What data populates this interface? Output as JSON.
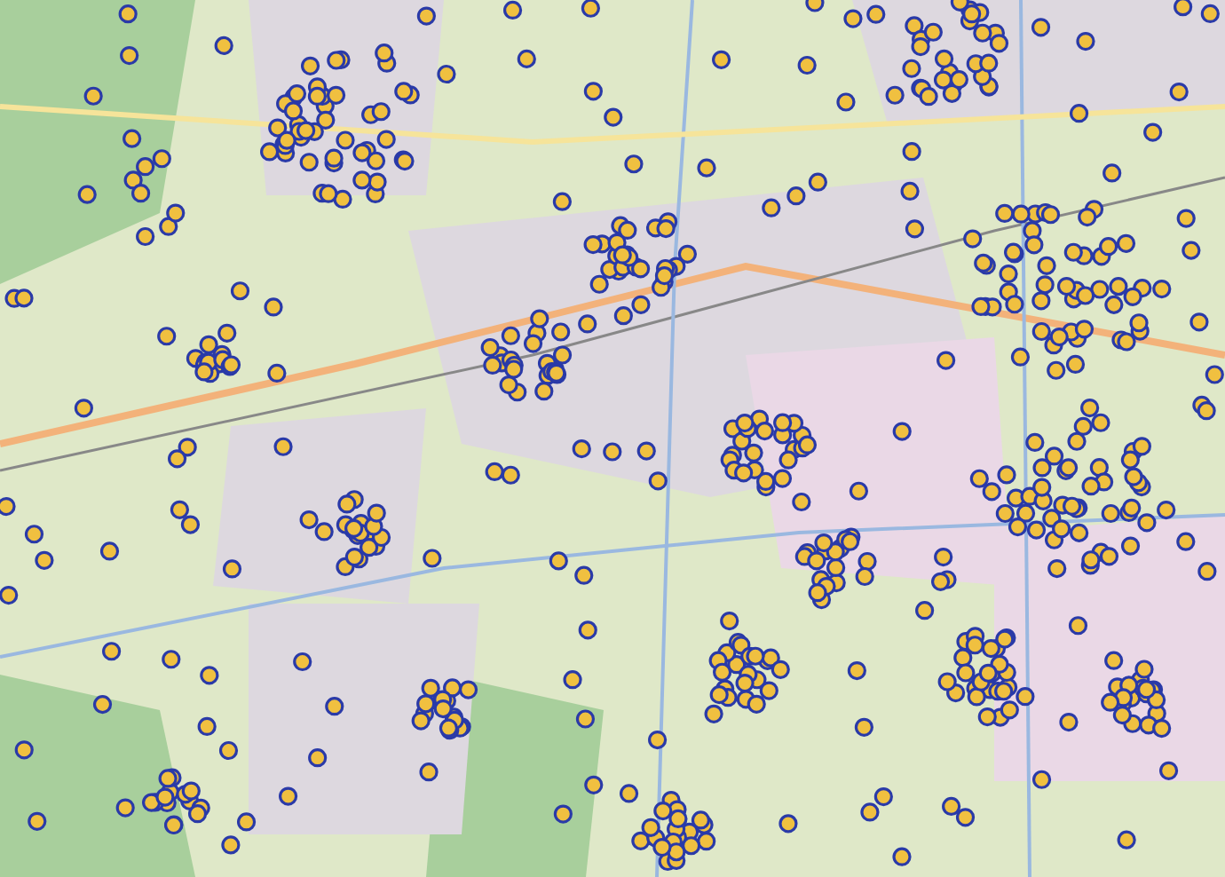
{
  "map": {
    "kind": "street-map",
    "show_markers": true
  }
}
